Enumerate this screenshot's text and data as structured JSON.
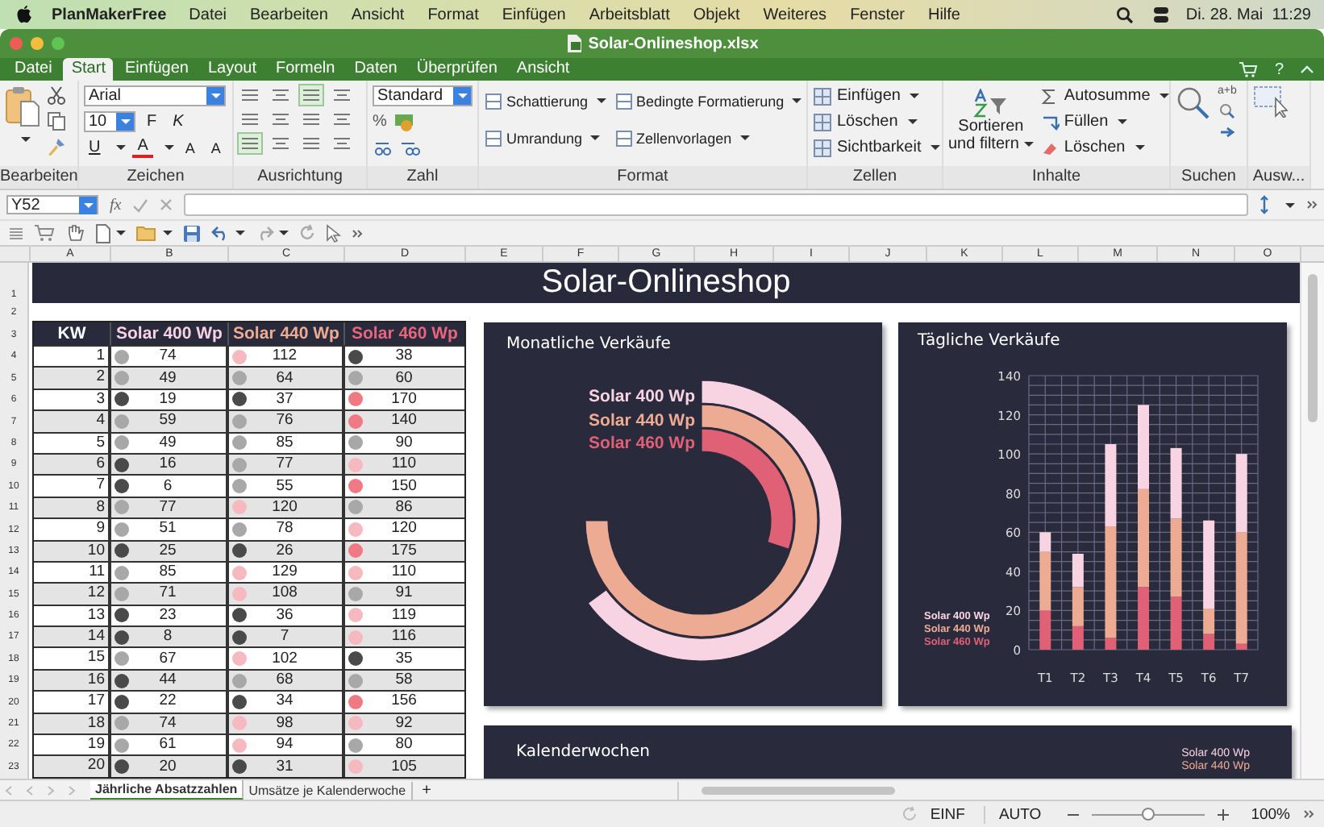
{
  "menubar": {
    "app": "PlanMakerFree",
    "items": [
      "Datei",
      "Bearbeiten",
      "Ansicht",
      "Format",
      "Einfügen",
      "Arbeitsblatt",
      "Objekt",
      "Weiteres",
      "Fenster",
      "Hilfe"
    ],
    "clock": "Di. 28. Mai  11:29"
  },
  "window": {
    "title": "Solar-Onlineshop.xlsx"
  },
  "ribbon_tabs": [
    {
      "label": "Datei",
      "selected": false
    },
    {
      "label": "Start",
      "selected": true
    },
    {
      "label": "Einfügen",
      "selected": false
    },
    {
      "label": "Layout",
      "selected": false
    },
    {
      "label": "Formeln",
      "selected": false
    },
    {
      "label": "Daten",
      "selected": false
    },
    {
      "label": "Überprüfen",
      "selected": false
    },
    {
      "label": "Ansicht",
      "selected": false
    }
  ],
  "help": "?",
  "ribbon_groups": [
    {
      "kind": "clipboard",
      "label": "Bearbeiten"
    },
    {
      "kind": "font",
      "label": "Zeichen",
      "font": "Arial",
      "size": "10",
      "buttons": [
        "F",
        "K",
        "U",
        "A",
        "A",
        "A"
      ]
    },
    {
      "kind": "alignment",
      "label": "Ausrichtung"
    },
    {
      "kind": "number",
      "label": "Zahl",
      "format": "Standard",
      "percent": "%"
    },
    {
      "kind": "format",
      "label": "Format",
      "commands": [
        "Schattierung",
        "Bedingte Formatierung",
        "Umrandung",
        "Zellenvorlagen"
      ]
    },
    {
      "kind": "cells",
      "label": "Zellen",
      "commands": [
        "Einfügen",
        "Löschen",
        "Sichtbarkeit"
      ]
    },
    {
      "kind": "contents",
      "label": "Inhalte",
      "sort": [
        "Sortieren",
        "und filtern"
      ],
      "commands": [
        "Autosumme",
        "Füllen",
        "Löschen"
      ]
    },
    {
      "kind": "search",
      "label": "Suchen",
      "replace": "a+b"
    },
    {
      "kind": "select",
      "label": "Ausw..."
    }
  ],
  "formula_bar": {
    "cell": "Y52",
    "fx": "fx"
  },
  "columns": [
    "A",
    "B",
    "C",
    "D",
    "E",
    "F",
    "G",
    "H",
    "I",
    "J",
    "K",
    "L",
    "M",
    "N",
    "O"
  ],
  "rows": [
    "1",
    "2",
    "3",
    "4",
    "5",
    "6",
    "7",
    "8",
    "9",
    "10",
    "11",
    "12",
    "13",
    "14",
    "15",
    "16",
    "17",
    "18",
    "19",
    "20",
    "21",
    "22",
    "23"
  ],
  "sheet_title": "Solar-Onlineshop",
  "table": {
    "columns": [
      {
        "label": "KW",
        "color": "#ffffff"
      },
      {
        "label": "Solar 400 Wp",
        "color": "#f6d2e2"
      },
      {
        "label": "Solar 440 Wp",
        "color": "#eeab93"
      },
      {
        "label": "Solar 460 Wp",
        "color": "#e8667c"
      }
    ],
    "rows": [
      {
        "cells": [
          {
            "value": "1"
          },
          {
            "value": "74",
            "color": "#a8a8a8"
          },
          {
            "value": "112",
            "color": "#f6b9c0"
          },
          {
            "value": "38",
            "color": "#4a4a4a"
          }
        ]
      },
      {
        "cells": [
          {
            "value": "2"
          },
          {
            "value": "49",
            "color": "#a8a8a8"
          },
          {
            "value": "64",
            "color": "#a8a8a8"
          },
          {
            "value": "60",
            "color": "#a8a8a8"
          }
        ]
      },
      {
        "cells": [
          {
            "value": "3"
          },
          {
            "value": "19",
            "color": "#4a4a4a"
          },
          {
            "value": "37",
            "color": "#4a4a4a"
          },
          {
            "value": "170",
            "color": "#f07a84"
          }
        ]
      },
      {
        "cells": [
          {
            "value": "4"
          },
          {
            "value": "59",
            "color": "#a8a8a8"
          },
          {
            "value": "76",
            "color": "#a8a8a8"
          },
          {
            "value": "140",
            "color": "#f07a84"
          }
        ]
      },
      {
        "cells": [
          {
            "value": "5"
          },
          {
            "value": "49",
            "color": "#a8a8a8"
          },
          {
            "value": "85",
            "color": "#a8a8a8"
          },
          {
            "value": "90",
            "color": "#a8a8a8"
          }
        ]
      },
      {
        "cells": [
          {
            "value": "6"
          },
          {
            "value": "16",
            "color": "#4a4a4a"
          },
          {
            "value": "77",
            "color": "#a8a8a8"
          },
          {
            "value": "110",
            "color": "#f6b9c0"
          }
        ]
      },
      {
        "cells": [
          {
            "value": "7"
          },
          {
            "value": "6",
            "color": "#4a4a4a"
          },
          {
            "value": "55",
            "color": "#a8a8a8"
          },
          {
            "value": "150",
            "color": "#f07a84"
          }
        ]
      },
      {
        "cells": [
          {
            "value": "8"
          },
          {
            "value": "77",
            "color": "#a8a8a8"
          },
          {
            "value": "120",
            "color": "#f6b9c0"
          },
          {
            "value": "86",
            "color": "#a8a8a8"
          }
        ]
      },
      {
        "cells": [
          {
            "value": "9"
          },
          {
            "value": "51",
            "color": "#a8a8a8"
          },
          {
            "value": "78",
            "color": "#a8a8a8"
          },
          {
            "value": "120",
            "color": "#f6b9c0"
          }
        ]
      },
      {
        "cells": [
          {
            "value": "10"
          },
          {
            "value": "25",
            "color": "#4a4a4a"
          },
          {
            "value": "26",
            "color": "#4a4a4a"
          },
          {
            "value": "175",
            "color": "#f07a84"
          }
        ]
      },
      {
        "cells": [
          {
            "value": "11"
          },
          {
            "value": "85",
            "color": "#a8a8a8"
          },
          {
            "value": "129",
            "color": "#f6b9c0"
          },
          {
            "value": "110",
            "color": "#f6b9c0"
          }
        ]
      },
      {
        "cells": [
          {
            "value": "12"
          },
          {
            "value": "71",
            "color": "#a8a8a8"
          },
          {
            "value": "108",
            "color": "#f6b9c0"
          },
          {
            "value": "91",
            "color": "#a8a8a8"
          }
        ]
      },
      {
        "cells": [
          {
            "value": "13"
          },
          {
            "value": "23",
            "color": "#4a4a4a"
          },
          {
            "value": "36",
            "color": "#4a4a4a"
          },
          {
            "value": "119",
            "color": "#f6b9c0"
          }
        ]
      },
      {
        "cells": [
          {
            "value": "14"
          },
          {
            "value": "8",
            "color": "#4a4a4a"
          },
          {
            "value": "7",
            "color": "#4a4a4a"
          },
          {
            "value": "116",
            "color": "#f6b9c0"
          }
        ]
      },
      {
        "cells": [
          {
            "value": "15"
          },
          {
            "value": "67",
            "color": "#a8a8a8"
          },
          {
            "value": "102",
            "color": "#f6b9c0"
          },
          {
            "value": "35",
            "color": "#4a4a4a"
          }
        ]
      },
      {
        "cells": [
          {
            "value": "16"
          },
          {
            "value": "44",
            "color": "#4a4a4a"
          },
          {
            "value": "68",
            "color": "#a8a8a8"
          },
          {
            "value": "58",
            "color": "#a8a8a8"
          }
        ]
      },
      {
        "cells": [
          {
            "value": "17"
          },
          {
            "value": "22",
            "color": "#4a4a4a"
          },
          {
            "value": "34",
            "color": "#4a4a4a"
          },
          {
            "value": "156",
            "color": "#f07a84"
          }
        ]
      },
      {
        "cells": [
          {
            "value": "18"
          },
          {
            "value": "74",
            "color": "#a8a8a8"
          },
          {
            "value": "98",
            "color": "#f6b9c0"
          },
          {
            "value": "92",
            "color": "#f6b9c0"
          }
        ]
      },
      {
        "cells": [
          {
            "value": "19"
          },
          {
            "value": "61",
            "color": "#a8a8a8"
          },
          {
            "value": "94",
            "color": "#f6b9c0"
          },
          {
            "value": "80",
            "color": "#a8a8a8"
          }
        ]
      },
      {
        "cells": [
          {
            "value": "20"
          },
          {
            "value": "20",
            "color": "#4a4a4a"
          },
          {
            "value": "31",
            "color": "#4a4a4a"
          },
          {
            "value": "105",
            "color": "#f6b9c0"
          }
        ]
      }
    ]
  },
  "radial_chart": {
    "title": "Monatliche Verkäufe",
    "legend": [
      {
        "label": "Solar 400 Wp",
        "color": "#f8d3e2"
      },
      {
        "label": "Solar 440 Wp",
        "color": "#eeab93"
      },
      {
        "label": "Solar 460 Wp",
        "color": "#e06075"
      }
    ]
  },
  "bar_chart": {
    "title": "Tägliche Verkäufe",
    "chart_data": {
      "type": "bar",
      "stacked": true,
      "grid": true,
      "categories": [
        "T1",
        "T2",
        "T3",
        "T4",
        "T5",
        "T6",
        "T7"
      ],
      "ylim": [
        0,
        140
      ],
      "yticks": [
        0,
        20,
        40,
        60,
        80,
        100,
        120,
        140
      ],
      "series": [
        {
          "name": "Solar 400 Wp",
          "color": "#f8d3e2",
          "values": [
            10,
            17,
            42,
            43,
            36,
            45,
            40
          ]
        },
        {
          "name": "Solar 440 Wp",
          "color": "#eeab93",
          "values": [
            30,
            20,
            57,
            50,
            40,
            13,
            57
          ]
        },
        {
          "name": "Solar 460 Wp",
          "color": "#e06075",
          "values": [
            20,
            12,
            6,
            32,
            27,
            8,
            3
          ]
        }
      ]
    }
  },
  "calendar_panel": {
    "title": "Kalenderwochen",
    "legend": [
      {
        "label": "Solar 400 Wp",
        "color": "#f8d3e2"
      },
      {
        "label": "Solar 440 Wp",
        "color": "#eeab93"
      }
    ]
  },
  "sheet_tabs": [
    {
      "label": "Jährliche Absatzzahlen",
      "selected": true
    },
    {
      "label": "Umsätze je Kalenderwoche",
      "selected": false
    }
  ],
  "add_sheet": "+",
  "status_bar": {
    "mode": "EINF",
    "auto": "AUTO",
    "zoom_slider": {
      "level": 0.5
    },
    "zoom": "100%"
  }
}
